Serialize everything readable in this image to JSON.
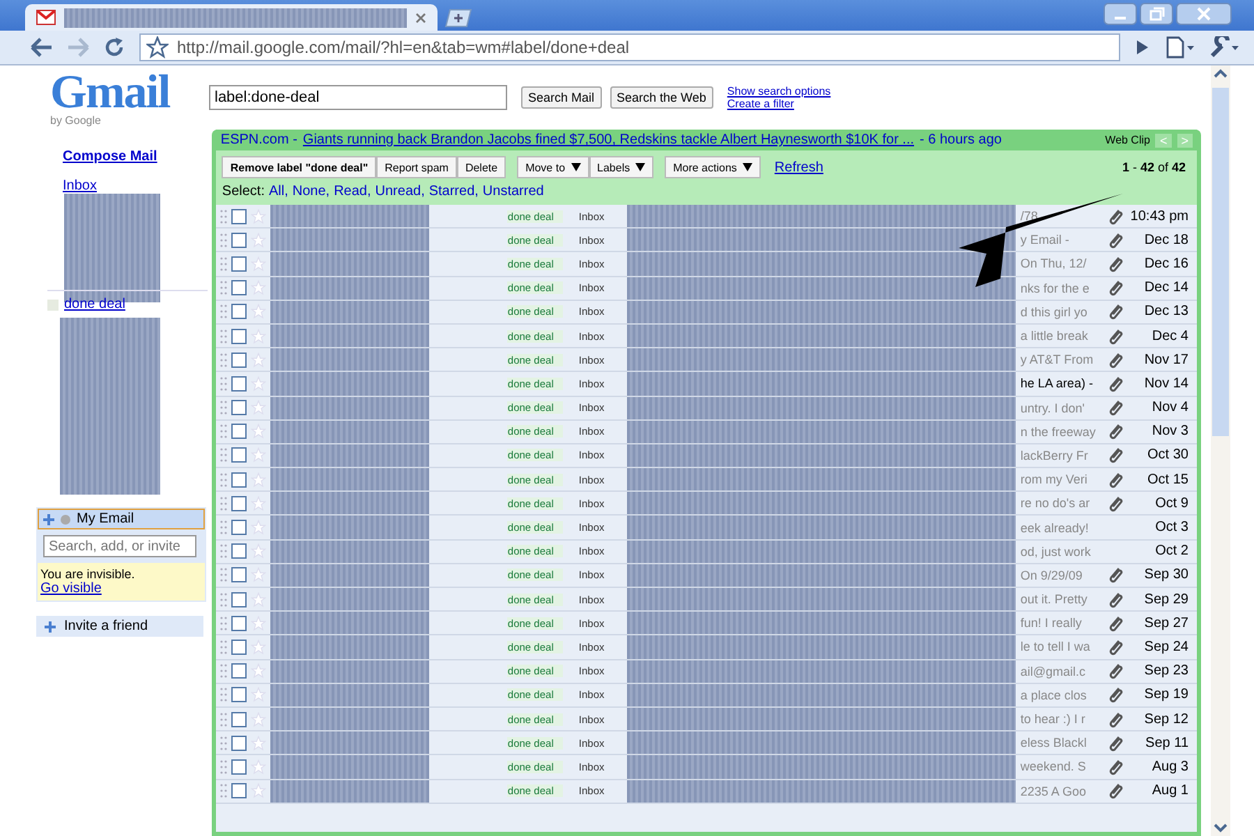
{
  "browser": {
    "url": "http://mail.google.com/mail/?hl=en&tab=wm#label/done+deal"
  },
  "header": {
    "logo": "Gmail",
    "logo_sub": "by Google",
    "search_value": "label:done-deal",
    "buttons": [
      "Search Mail",
      "Search the Web"
    ],
    "links": [
      "Show search options",
      "Create a filter"
    ]
  },
  "sidebar": {
    "compose": "Compose Mail",
    "inbox": "Inbox",
    "label": "done deal"
  },
  "chat": {
    "title": "My Email",
    "placeholder": "Search, add, or invite",
    "status": "You are invisible.",
    "link": "Go visible",
    "invite": "Invite a friend"
  },
  "webclip": {
    "source": "ESPN.com -",
    "headline": "Giants running back Brandon Jacobs fined $7,500, Redskins tackle Albert Haynesworth $10K for ...",
    "age": "- 6 hours ago",
    "label": "Web Clip",
    "prev": "<",
    "next": ">"
  },
  "toolbar": {
    "buttons": [
      {
        "label": "Remove label \"done deal\"",
        "kind": "bold",
        "dropdown": false
      },
      {
        "label": "Report spam",
        "kind": "plain",
        "dropdown": false
      },
      {
        "label": "Delete",
        "kind": "plain",
        "dropdown": false
      },
      {
        "label": "Move to",
        "kind": "plain",
        "dropdown": true
      },
      {
        "label": "Labels",
        "kind": "plain",
        "dropdown": true
      },
      {
        "label": "More actions",
        "kind": "plain",
        "dropdown": true
      }
    ],
    "refresh": "Refresh",
    "count": "**1** - **42** of **42**"
  },
  "select": {
    "label": "Select:",
    "options": [
      "All,",
      "None,",
      "Read,",
      "Unread,",
      "Starred,",
      "Unstarred"
    ]
  },
  "rows": [
    {
      "checked": false,
      "starred": false,
      "labels": [
        "done deal",
        "Inbox"
      ],
      "snippet": "/78",
      "unread": false,
      "attachment": true,
      "date": "10:43 pm"
    },
    {
      "checked": false,
      "starred": false,
      "labels": [
        "done deal",
        "Inbox"
      ],
      "snippet": "y Email -",
      "unread": false,
      "attachment": true,
      "date": "Dec 18"
    },
    {
      "checked": false,
      "starred": false,
      "labels": [
        "done deal",
        "Inbox"
      ],
      "snippet": "On Thu, 12/",
      "unread": false,
      "attachment": true,
      "date": "Dec 16"
    },
    {
      "checked": false,
      "starred": false,
      "labels": [
        "done deal",
        "Inbox"
      ],
      "snippet": "nks for the e",
      "unread": false,
      "attachment": true,
      "date": "Dec 14"
    },
    {
      "checked": false,
      "starred": false,
      "labels": [
        "done deal",
        "Inbox"
      ],
      "snippet": "d this girl yo",
      "unread": false,
      "attachment": true,
      "date": "Dec 13"
    },
    {
      "checked": false,
      "starred": false,
      "labels": [
        "done deal",
        "Inbox"
      ],
      "snippet": "a little break",
      "unread": false,
      "attachment": true,
      "date": "Dec 4"
    },
    {
      "checked": false,
      "starred": false,
      "labels": [
        "done deal",
        "Inbox"
      ],
      "snippet": "y AT&T From",
      "unread": false,
      "attachment": true,
      "date": "Nov 17"
    },
    {
      "checked": false,
      "starred": false,
      "labels": [
        "done deal",
        "Inbox"
      ],
      "snippet": "he LA area) -",
      "unread": true,
      "attachment": true,
      "date": "Nov 14"
    },
    {
      "checked": false,
      "starred": false,
      "labels": [
        "done deal",
        "Inbox"
      ],
      "snippet": "untry. I don'",
      "unread": false,
      "attachment": true,
      "date": "Nov 4"
    },
    {
      "checked": false,
      "starred": false,
      "labels": [
        "done deal",
        "Inbox"
      ],
      "snippet": "n the freeway",
      "unread": false,
      "attachment": true,
      "date": "Nov 3"
    },
    {
      "checked": false,
      "starred": false,
      "labels": [
        "done deal",
        "Inbox"
      ],
      "snippet": "lackBerry Fr",
      "unread": false,
      "attachment": true,
      "date": "Oct 30"
    },
    {
      "checked": false,
      "starred": false,
      "labels": [
        "done deal",
        "Inbox"
      ],
      "snippet": "rom my Veri",
      "unread": false,
      "attachment": true,
      "date": "Oct 15"
    },
    {
      "checked": false,
      "starred": false,
      "labels": [
        "done deal",
        "Inbox"
      ],
      "snippet": "re no do's ar",
      "unread": false,
      "attachment": true,
      "date": "Oct 9"
    },
    {
      "checked": false,
      "starred": false,
      "labels": [
        "done deal",
        "Inbox"
      ],
      "snippet": "eek already!",
      "unread": false,
      "attachment": false,
      "date": "Oct 3"
    },
    {
      "checked": false,
      "starred": false,
      "labels": [
        "done deal",
        "Inbox"
      ],
      "snippet": "od, just work",
      "unread": false,
      "attachment": false,
      "date": "Oct 2"
    },
    {
      "checked": false,
      "starred": false,
      "labels": [
        "done deal",
        "Inbox"
      ],
      "snippet": "On 9/29/09",
      "unread": false,
      "attachment": true,
      "date": "Sep 30"
    },
    {
      "checked": false,
      "starred": false,
      "labels": [
        "done deal",
        "Inbox"
      ],
      "snippet": "out it. Pretty",
      "unread": false,
      "attachment": true,
      "date": "Sep 29"
    },
    {
      "checked": false,
      "starred": false,
      "labels": [
        "done deal",
        "Inbox"
      ],
      "snippet": "fun! I really",
      "unread": false,
      "attachment": true,
      "date": "Sep 27"
    },
    {
      "checked": false,
      "starred": false,
      "labels": [
        "done deal",
        "Inbox"
      ],
      "snippet": "le to tell I wa",
      "unread": false,
      "attachment": true,
      "date": "Sep 24"
    },
    {
      "checked": false,
      "starred": false,
      "labels": [
        "done deal",
        "Inbox"
      ],
      "snippet": "ail@gmail.c",
      "unread": false,
      "attachment": true,
      "date": "Sep 23"
    },
    {
      "checked": false,
      "starred": false,
      "labels": [
        "done deal",
        "Inbox"
      ],
      "snippet": "a place clos",
      "unread": false,
      "attachment": true,
      "date": "Sep 19"
    },
    {
      "checked": false,
      "starred": false,
      "labels": [
        "done deal",
        "Inbox"
      ],
      "snippet": "to hear :) I r",
      "unread": false,
      "attachment": true,
      "date": "Sep 12"
    },
    {
      "checked": false,
      "starred": false,
      "labels": [
        "done deal",
        "Inbox"
      ],
      "snippet": "eless Blackl",
      "unread": false,
      "attachment": true,
      "date": "Sep 11"
    },
    {
      "checked": false,
      "starred": false,
      "labels": [
        "done deal",
        "Inbox"
      ],
      "snippet": "weekend. S",
      "unread": false,
      "attachment": true,
      "date": "Aug 3"
    },
    {
      "checked": false,
      "starred": false,
      "labels": [
        "done deal",
        "Inbox"
      ],
      "snippet": "2235 A Goo",
      "unread": false,
      "attachment": true,
      "date": "Aug 1"
    }
  ]
}
